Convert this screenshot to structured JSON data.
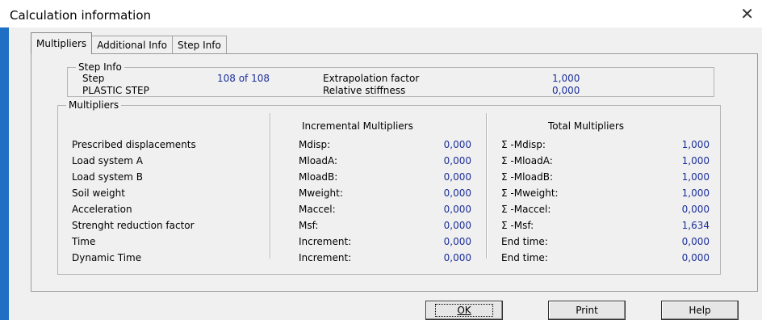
{
  "window": {
    "title": "Calculation information",
    "close_glyph": "✕"
  },
  "tabs": [
    {
      "label": "Multipliers"
    },
    {
      "label": "Additional Info"
    },
    {
      "label": "Step Info"
    }
  ],
  "step_info": {
    "group_label": "Step Info",
    "step_label": "Step",
    "step_value": "108 of 108",
    "step_type": "PLASTIC STEP",
    "extrapolation_label": "Extrapolation factor",
    "extrapolation_value": "1,000",
    "stiffness_label": "Relative stiffness",
    "stiffness_value": "0,000"
  },
  "multipliers": {
    "group_label": "Multipliers",
    "incremental_header": "Incremental Multipliers",
    "total_header": "Total Multipliers",
    "rows": [
      {
        "name": "Prescribed displacements",
        "inc_label": "Mdisp:",
        "inc_value": "0,000",
        "tot_label": "Σ -Mdisp:",
        "tot_value": "1,000"
      },
      {
        "name": "Load system A",
        "inc_label": "MloadA:",
        "inc_value": "0,000",
        "tot_label": "Σ -MloadA:",
        "tot_value": "1,000"
      },
      {
        "name": "Load system B",
        "inc_label": "MloadB:",
        "inc_value": "0,000",
        "tot_label": "Σ -MloadB:",
        "tot_value": "1,000"
      },
      {
        "name": "Soil weight",
        "inc_label": "Mweight:",
        "inc_value": "0,000",
        "tot_label": "Σ -Mweight:",
        "tot_value": "1,000"
      },
      {
        "name": "Acceleration",
        "inc_label": "Maccel:",
        "inc_value": "0,000",
        "tot_label": "Σ -Maccel:",
        "tot_value": "0,000"
      },
      {
        "name": "Strenght reduction factor",
        "inc_label": "Msf:",
        "inc_value": "0,000",
        "tot_label": "Σ -Msf:",
        "tot_value": "1,634"
      },
      {
        "name": "Time",
        "inc_label": "Increment:",
        "inc_value": "0,000",
        "tot_label": "End time:",
        "tot_value": "0,000"
      },
      {
        "name": "Dynamic Time",
        "inc_label": "Increment:",
        "inc_value": "0,000",
        "tot_label": "End time:",
        "tot_value": "0,000"
      }
    ]
  },
  "buttons": {
    "ok_label": "OK",
    "print_label": "Print",
    "help_label": "Help"
  },
  "colors": {
    "value_text": "#1c2f99",
    "left_accent": "#1f6fc4"
  }
}
